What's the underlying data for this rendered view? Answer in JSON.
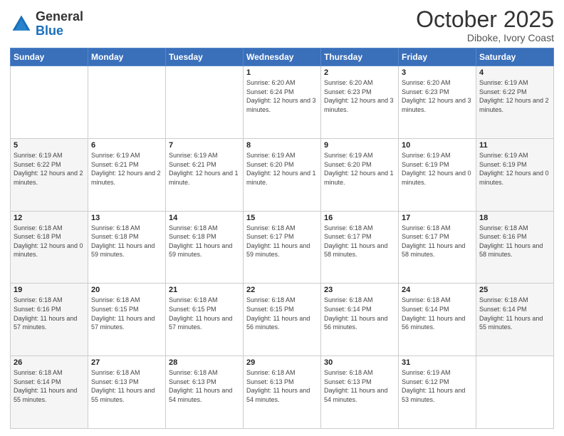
{
  "logo": {
    "general": "General",
    "blue": "Blue"
  },
  "header": {
    "month": "October 2025",
    "location": "Diboke, Ivory Coast"
  },
  "days_of_week": [
    "Sunday",
    "Monday",
    "Tuesday",
    "Wednesday",
    "Thursday",
    "Friday",
    "Saturday"
  ],
  "weeks": [
    [
      {
        "day": "",
        "info": ""
      },
      {
        "day": "",
        "info": ""
      },
      {
        "day": "",
        "info": ""
      },
      {
        "day": "1",
        "info": "Sunrise: 6:20 AM\nSunset: 6:24 PM\nDaylight: 12 hours and 3 minutes."
      },
      {
        "day": "2",
        "info": "Sunrise: 6:20 AM\nSunset: 6:23 PM\nDaylight: 12 hours and 3 minutes."
      },
      {
        "day": "3",
        "info": "Sunrise: 6:20 AM\nSunset: 6:23 PM\nDaylight: 12 hours and 3 minutes."
      },
      {
        "day": "4",
        "info": "Sunrise: 6:19 AM\nSunset: 6:22 PM\nDaylight: 12 hours and 2 minutes."
      }
    ],
    [
      {
        "day": "5",
        "info": "Sunrise: 6:19 AM\nSunset: 6:22 PM\nDaylight: 12 hours and 2 minutes."
      },
      {
        "day": "6",
        "info": "Sunrise: 6:19 AM\nSunset: 6:21 PM\nDaylight: 12 hours and 2 minutes."
      },
      {
        "day": "7",
        "info": "Sunrise: 6:19 AM\nSunset: 6:21 PM\nDaylight: 12 hours and 1 minute."
      },
      {
        "day": "8",
        "info": "Sunrise: 6:19 AM\nSunset: 6:20 PM\nDaylight: 12 hours and 1 minute."
      },
      {
        "day": "9",
        "info": "Sunrise: 6:19 AM\nSunset: 6:20 PM\nDaylight: 12 hours and 1 minute."
      },
      {
        "day": "10",
        "info": "Sunrise: 6:19 AM\nSunset: 6:19 PM\nDaylight: 12 hours and 0 minutes."
      },
      {
        "day": "11",
        "info": "Sunrise: 6:19 AM\nSunset: 6:19 PM\nDaylight: 12 hours and 0 minutes."
      }
    ],
    [
      {
        "day": "12",
        "info": "Sunrise: 6:18 AM\nSunset: 6:18 PM\nDaylight: 12 hours and 0 minutes."
      },
      {
        "day": "13",
        "info": "Sunrise: 6:18 AM\nSunset: 6:18 PM\nDaylight: 11 hours and 59 minutes."
      },
      {
        "day": "14",
        "info": "Sunrise: 6:18 AM\nSunset: 6:18 PM\nDaylight: 11 hours and 59 minutes."
      },
      {
        "day": "15",
        "info": "Sunrise: 6:18 AM\nSunset: 6:17 PM\nDaylight: 11 hours and 59 minutes."
      },
      {
        "day": "16",
        "info": "Sunrise: 6:18 AM\nSunset: 6:17 PM\nDaylight: 11 hours and 58 minutes."
      },
      {
        "day": "17",
        "info": "Sunrise: 6:18 AM\nSunset: 6:17 PM\nDaylight: 11 hours and 58 minutes."
      },
      {
        "day": "18",
        "info": "Sunrise: 6:18 AM\nSunset: 6:16 PM\nDaylight: 11 hours and 58 minutes."
      }
    ],
    [
      {
        "day": "19",
        "info": "Sunrise: 6:18 AM\nSunset: 6:16 PM\nDaylight: 11 hours and 57 minutes."
      },
      {
        "day": "20",
        "info": "Sunrise: 6:18 AM\nSunset: 6:15 PM\nDaylight: 11 hours and 57 minutes."
      },
      {
        "day": "21",
        "info": "Sunrise: 6:18 AM\nSunset: 6:15 PM\nDaylight: 11 hours and 57 minutes."
      },
      {
        "day": "22",
        "info": "Sunrise: 6:18 AM\nSunset: 6:15 PM\nDaylight: 11 hours and 56 minutes."
      },
      {
        "day": "23",
        "info": "Sunrise: 6:18 AM\nSunset: 6:14 PM\nDaylight: 11 hours and 56 minutes."
      },
      {
        "day": "24",
        "info": "Sunrise: 6:18 AM\nSunset: 6:14 PM\nDaylight: 11 hours and 56 minutes."
      },
      {
        "day": "25",
        "info": "Sunrise: 6:18 AM\nSunset: 6:14 PM\nDaylight: 11 hours and 55 minutes."
      }
    ],
    [
      {
        "day": "26",
        "info": "Sunrise: 6:18 AM\nSunset: 6:14 PM\nDaylight: 11 hours and 55 minutes."
      },
      {
        "day": "27",
        "info": "Sunrise: 6:18 AM\nSunset: 6:13 PM\nDaylight: 11 hours and 55 minutes."
      },
      {
        "day": "28",
        "info": "Sunrise: 6:18 AM\nSunset: 6:13 PM\nDaylight: 11 hours and 54 minutes."
      },
      {
        "day": "29",
        "info": "Sunrise: 6:18 AM\nSunset: 6:13 PM\nDaylight: 11 hours and 54 minutes."
      },
      {
        "day": "30",
        "info": "Sunrise: 6:18 AM\nSunset: 6:13 PM\nDaylight: 11 hours and 54 minutes."
      },
      {
        "day": "31",
        "info": "Sunrise: 6:19 AM\nSunset: 6:12 PM\nDaylight: 11 hours and 53 minutes."
      },
      {
        "day": "",
        "info": ""
      }
    ]
  ]
}
